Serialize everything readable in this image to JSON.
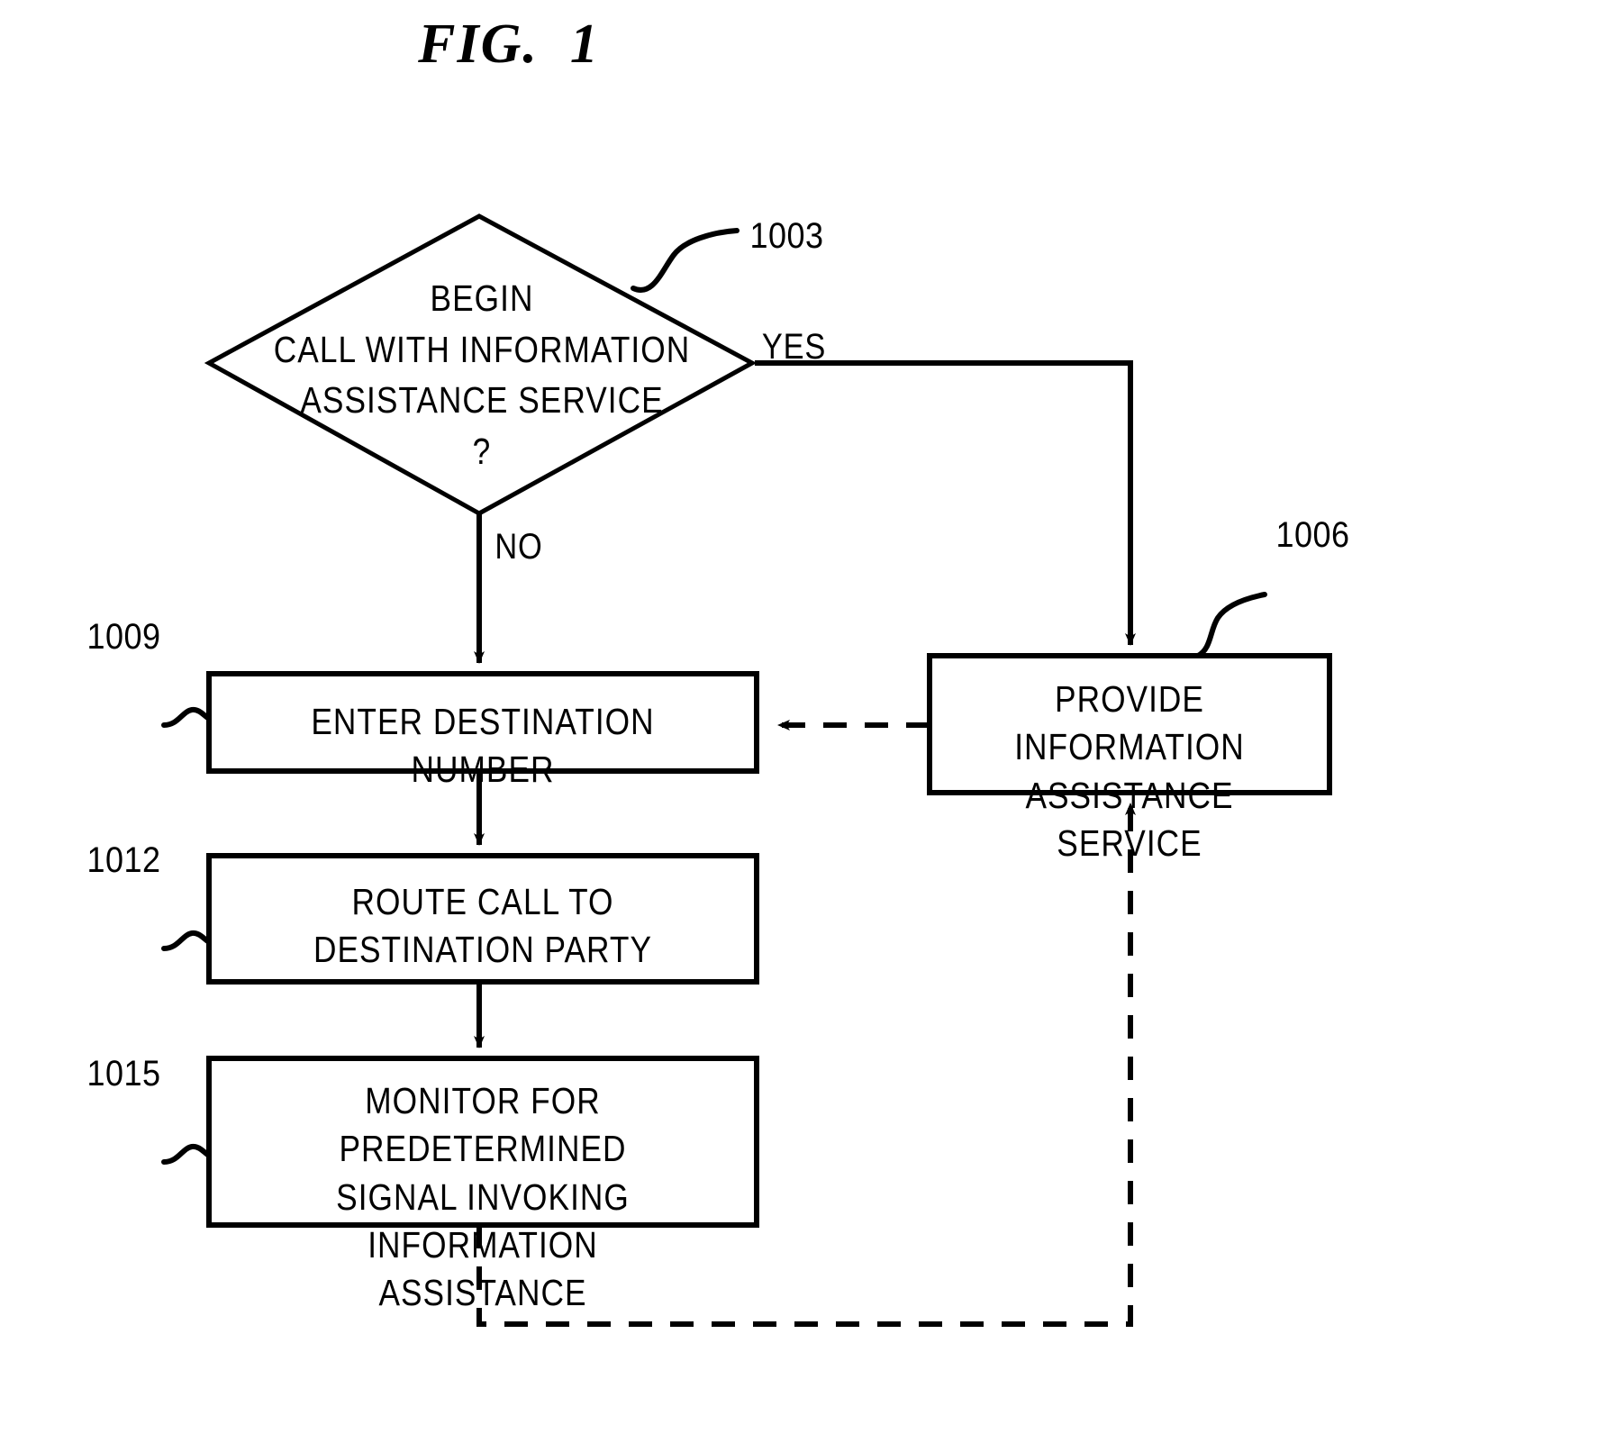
{
  "figure": {
    "title": "FIG.  1"
  },
  "nodes": {
    "decision": {
      "ref": "1003",
      "text": "BEGIN\nCALL WITH INFORMATION\nASSISTANCE SERVICE\n?",
      "shape": "diamond"
    },
    "enter_destination": {
      "ref": "1009",
      "text": "ENTER DESTINATION NUMBER",
      "shape": "process"
    },
    "provide_information": {
      "ref": "1006",
      "text": "PROVIDE INFORMATION\nASSISTANCE SERVICE",
      "shape": "process"
    },
    "route_call": {
      "ref": "1012",
      "text": "ROUTE CALL TO\nDESTINATION PARTY",
      "shape": "process"
    },
    "monitor_signal": {
      "ref": "1015",
      "text": "MONITOR FOR PREDETERMINED\nSIGNAL INVOKING INFORMATION\nASSISTANCE",
      "shape": "process"
    }
  },
  "branches": {
    "yes_label": "YES",
    "no_label": "NO"
  },
  "colors": {
    "ink": "#000000",
    "background": "#ffffff"
  }
}
